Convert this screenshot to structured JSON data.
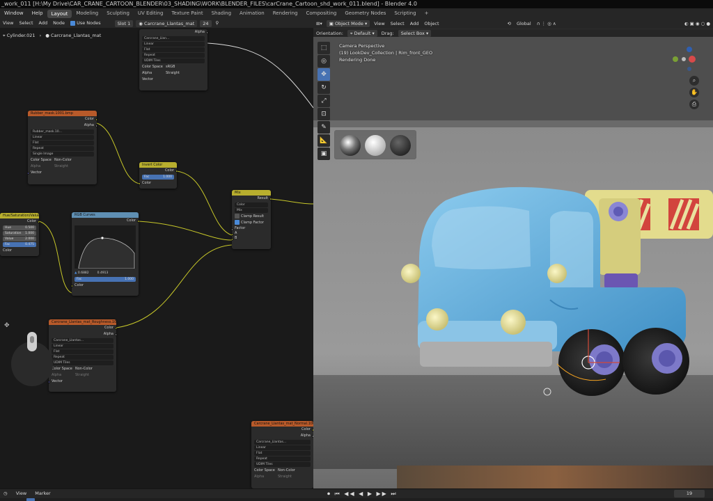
{
  "titlebar": {
    "text": "_work_011 [H:\\My Drive\\CAR_CRANE_CARTOON_BLENDER\\03_SHADING\\WORK\\BLENDER_FILES\\carCrane_Cartoon_shd_work_011.blend] - Blender 4.0"
  },
  "menu": {
    "items": [
      "Window",
      "Help"
    ],
    "workspaces": [
      "Layout",
      "Modeling",
      "Sculpting",
      "UV Editing",
      "Texture Paint",
      "Shading",
      "Animation",
      "Rendering",
      "Compositing",
      "Geometry Nodes",
      "Scripting",
      "+"
    ],
    "active_workspace": "Layout"
  },
  "node_editor": {
    "header": {
      "view": "View",
      "select": "Select",
      "add": "Add",
      "node": "Node",
      "use_nodes": "Use Nodes",
      "slot": "Slot 1",
      "material": "Carcrane_Llantas_mat",
      "users": "24"
    },
    "breadcrumb": {
      "object": "Cylinder.021",
      "material": "Carcrane_Llantas_mat"
    },
    "nodes": {
      "top_image": {
        "alpha": "Alpha",
        "image": "Carcrane_Llan...",
        "interp": "Linear",
        "proj": "Flat",
        "ext": "Repeat",
        "source": "UDIM Tiles",
        "cs_label": "Color Space",
        "cs_value": "sRGB",
        "alpha_label": "Alpha",
        "alpha_value": "Straight",
        "vector": "Vector"
      },
      "rubber_mask": {
        "title": "Rubber_mask.1001.bmp",
        "color": "Color",
        "alpha": "Alpha",
        "image": "Rubber_mask.10...",
        "interp": "Linear",
        "proj": "Flat",
        "ext": "Repeat",
        "source": "Single Image",
        "cs_label": "Color Space",
        "cs_value": "Non-Color",
        "alpha_label": "Alpha",
        "alpha_value": "Straight",
        "vector": "Vector"
      },
      "invert": {
        "title": "Invert Color",
        "color_out": "Color",
        "fac_label": "Fac",
        "fac_value": "1.000",
        "color_in": "Color"
      },
      "hsv": {
        "title": "Hue/Saturation/Value",
        "color_out": "Color",
        "hue_label": "Hue",
        "hue_value": "0.500",
        "sat_label": "Saturation",
        "sat_value": "1.000",
        "val_label": "Value",
        "val_value": "2.000",
        "fac_label": "Fac",
        "fac_value": "0.475",
        "color_in": "Color"
      },
      "rgb_curves": {
        "title": "RGB Curves",
        "color_out": "Color",
        "coord_x": "0.6882",
        "coord_y": "0.4913",
        "fac_label": "Fac",
        "fac_value": "1.000",
        "color_in": "Color"
      },
      "mix": {
        "title": "Mix",
        "result": "Result",
        "type": "Color",
        "blend": "Mix",
        "clamp_result": "Clamp Result",
        "clamp_factor": "Clamp Factor",
        "factor": "Factor",
        "a": "A",
        "b": "B"
      },
      "roughness": {
        "title": "Carcrane_Llantas_mat_Roughness.100...",
        "color": "Color",
        "alpha": "Alpha",
        "image": "Carcrane_Llantas...",
        "interp": "Linear",
        "proj": "Flat",
        "ext": "Repeat",
        "source": "UDIM Tiles",
        "cs_label": "Color Space",
        "cs_value": "Non-Color",
        "alpha_label": "Alpha",
        "alpha_value": "Straight",
        "vector": "Vector"
      },
      "normal": {
        "title": "Carcrane_Llantas_mat_Normal.1001.png",
        "color": "Color",
        "alpha": "Alpha",
        "image": "Carcrane_Llantas...",
        "interp": "Linear",
        "proj": "Flat",
        "ext": "Repeat",
        "source": "UDIM Tiles",
        "cs_label": "Color Space",
        "cs_value": "Non-Color",
        "alpha_label": "Alpha",
        "alpha_value": "Straight"
      }
    }
  },
  "viewport": {
    "header": {
      "mode": "Object Mode",
      "view": "View",
      "select": "Select",
      "add": "Add",
      "object": "Object",
      "transform": "Global"
    },
    "subheader": {
      "orientation_label": "Orientation:",
      "orientation_value": "Default",
      "drag_label": "Drag:",
      "drag_value": "Select Box"
    },
    "overlay": {
      "line1": "Camera Perspective",
      "line2": "(19) LookDev_Collection | Rim_front_GEO",
      "line3": "Rendering Done"
    }
  },
  "timeline": {
    "view": "View",
    "marker": "Marker",
    "frame": "19",
    "playback_symbols": "⏺ ⏮ ◀◀ ◀ ▶ ▶▶ ⏭"
  },
  "colors": {
    "accent": "#4772b3",
    "truck_body": "#6fb2dd",
    "crane": "#e6e08a",
    "tire": "#1c1c1c",
    "hub": "#7d79c9",
    "headlight": "#ece7a6"
  },
  "icons": [
    "editor-type-icon",
    "cursor-tool-icon",
    "move-tool-icon",
    "rotate-tool-icon",
    "scale-tool-icon",
    "transform-tool-icon",
    "annotate-tool-icon",
    "measure-tool-icon",
    "add-cube-icon",
    "zoom-icon",
    "pan-hand-icon",
    "camera-icon",
    "mouse-icon"
  ]
}
